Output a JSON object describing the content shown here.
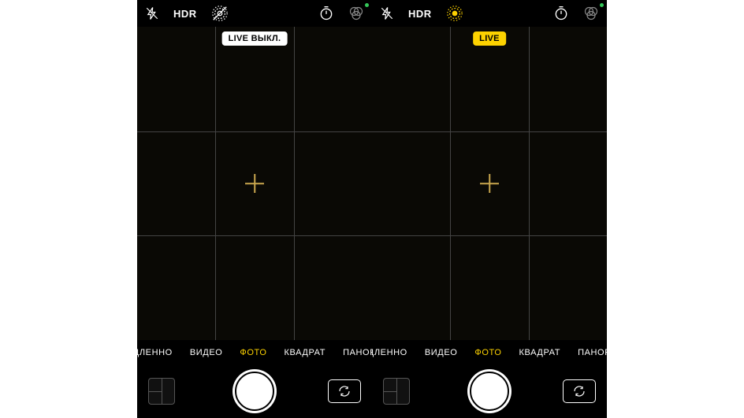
{
  "colors": {
    "accent": "#fdd200",
    "active_dot": "#34c759"
  },
  "left": {
    "topbar": {
      "hdr": "HDR",
      "live_active": false
    },
    "pill": {
      "text": "LIVE ВЫКЛ.",
      "style": "white"
    },
    "modes": [
      "ЕДЛЕННО",
      "ВИДЕО",
      "ФОТО",
      "КВАДРАТ",
      "ПАНОР"
    ],
    "active_mode": 2
  },
  "right": {
    "topbar": {
      "hdr": "HDR",
      "live_active": true
    },
    "pill": {
      "text": "LIVE",
      "style": "yellow"
    },
    "modes": [
      "ЕДЛЕННО",
      "ВИДЕО",
      "ФОТО",
      "КВАДРАТ",
      "ПАНОР"
    ],
    "active_mode": 2
  }
}
